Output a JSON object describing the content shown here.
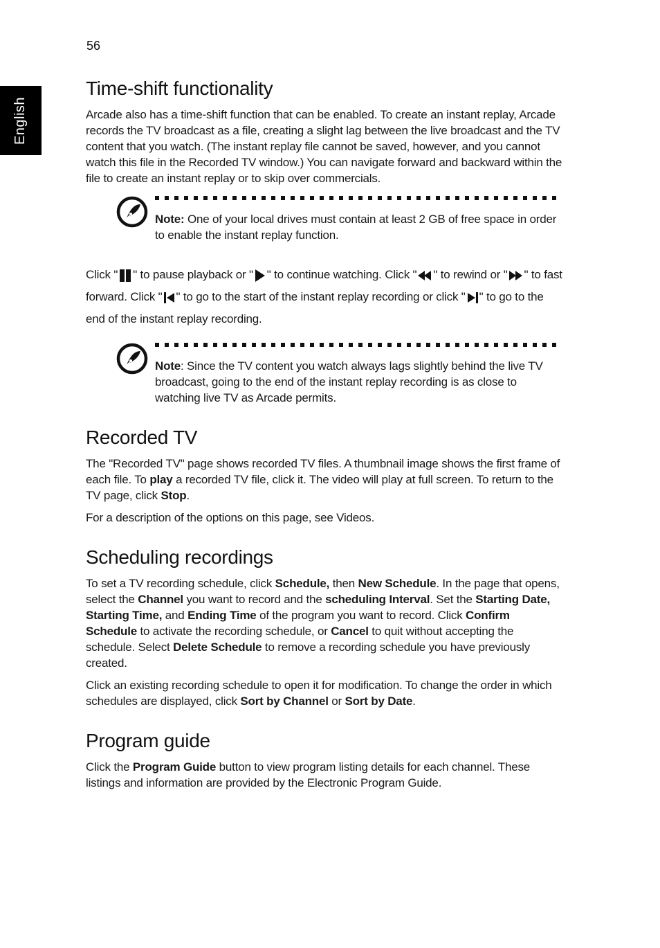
{
  "page": {
    "number": "56",
    "language_tab": "English"
  },
  "sections": {
    "time_shift": {
      "heading": "Time-shift functionality",
      "paragraph": "Arcade also has a time-shift function that can be enabled. To create an instant replay, Arcade records the TV broadcast as a file, creating a slight lag between the live broadcast and the TV content that you watch. (The instant replay file cannot be saved, however, and you cannot watch this file in the Recorded TV window.) You can navigate forward and backward within the file to create an instant replay or to skip over commercials.",
      "note1": {
        "label": "Note:",
        "text": " One of your local drives must contain at least 2 GB of free space in order to enable the instant replay function."
      },
      "controls": {
        "t1": "Click \"",
        "t2": "\" to pause playback or \"",
        "t3": "\" to continue watching. Click \"",
        "t4": "\" to rewind or \"",
        "t5": "\" to fast forward. Click \"",
        "t6": "\" to go to the start of the instant replay recording or click \"",
        "t7": "\" to go to the end of the instant replay recording.",
        "icons": [
          "pause-icon",
          "play-icon",
          "rewind-icon",
          "fast-forward-icon",
          "skip-to-start-icon",
          "skip-to-end-icon"
        ]
      },
      "note2": {
        "label": "Note",
        "text": ": Since the TV content you watch always lags slightly behind the live TV broadcast, going to the end of the instant replay recording is as close to watching live TV as Arcade permits."
      }
    },
    "recorded_tv": {
      "heading": "Recorded TV",
      "p1_a": "The \"Recorded TV\" page shows recorded TV files. A thumbnail image shows the first frame of each file. To ",
      "p1_play": "play",
      "p1_b": " a recorded TV file, click it. The video will play at full screen. To return to the TV page, click ",
      "p1_stop": "Stop",
      "p1_c": ".",
      "p2": "For a description of the options on this page, see Videos."
    },
    "scheduling": {
      "heading": "Scheduling recordings",
      "p1": [
        {
          "t": "To set a TV recording schedule, click ",
          "b": false
        },
        {
          "t": "Schedule,",
          "b": true
        },
        {
          "t": " then ",
          "b": false
        },
        {
          "t": "New Schedule",
          "b": true
        },
        {
          "t": ". In the page that opens, select the ",
          "b": false
        },
        {
          "t": "Channel",
          "b": true
        },
        {
          "t": " you want to record and the ",
          "b": false
        },
        {
          "t": "scheduling Interval",
          "b": true
        },
        {
          "t": ". Set the ",
          "b": false
        },
        {
          "t": "Starting Date, Starting Time,",
          "b": true
        },
        {
          "t": " and ",
          "b": false
        },
        {
          "t": "Ending Time",
          "b": true
        },
        {
          "t": " of the program you want to record. Click ",
          "b": false
        },
        {
          "t": "Confirm Schedule",
          "b": true
        },
        {
          "t": " to activate the recording schedule, or ",
          "b": false
        },
        {
          "t": "Cancel",
          "b": true
        },
        {
          "t": " to quit without accepting the schedule. Select ",
          "b": false
        },
        {
          "t": "Delete Schedule",
          "b": true
        },
        {
          "t": " to remove a recording schedule you have previously created.",
          "b": false
        }
      ],
      "p2": [
        {
          "t": "Click an existing recording schedule to open it for modification. To change the order in which schedules are displayed, click ",
          "b": false
        },
        {
          "t": "Sort by Channel",
          "b": true
        },
        {
          "t": " or ",
          "b": false
        },
        {
          "t": "Sort by Date",
          "b": true
        },
        {
          "t": ".",
          "b": false
        }
      ]
    },
    "program_guide": {
      "heading": "Program guide",
      "p1_a": "Click the ",
      "p1_bold": "Program Guide",
      "p1_b": " button to view program listing details for each channel. These listings and information are provided by the Electronic Program Guide."
    }
  }
}
